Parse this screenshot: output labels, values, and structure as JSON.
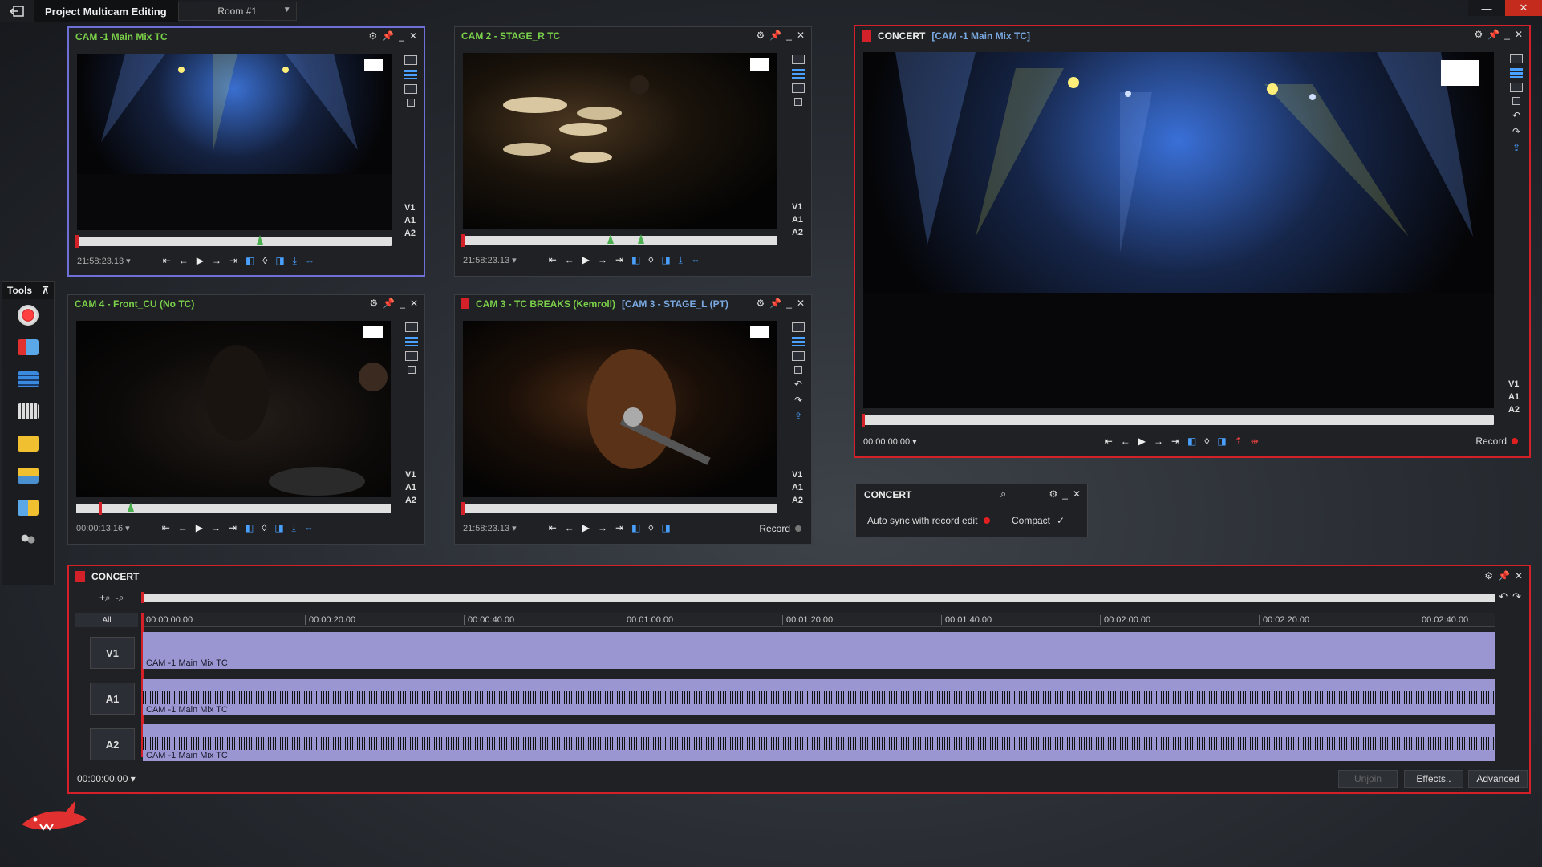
{
  "app": {
    "project": "Project Multicam Editing",
    "room": "Room #1"
  },
  "colors": {
    "accent_red": "#d42028",
    "select": "#6f6fd8",
    "clip": "#9a96d2",
    "cam_green": "#7bd04a"
  },
  "cam1": {
    "title": "CAM -1 Main Mix TC",
    "tc": "21:58:23.13 ▾",
    "tracks": [
      "V1",
      "A1",
      "A2"
    ]
  },
  "cam2": {
    "title": "CAM 2 - STAGE_R TC",
    "tc": "21:58:23.13 ▾",
    "tracks": [
      "V1",
      "A1",
      "A2"
    ]
  },
  "cam4": {
    "title": "CAM 4 - Front_CU  (No TC)",
    "tc": "00:00:13.16 ▾",
    "tracks": [
      "V1",
      "A1",
      "A2"
    ]
  },
  "cam3": {
    "title": "CAM 3 - TC BREAKS (Kemroll)",
    "sub": "[CAM 3 - STAGE_L (PT)",
    "tc": "21:58:23.13 ▾",
    "record": "Record",
    "tracks": [
      "V1",
      "A1",
      "A2"
    ]
  },
  "record": {
    "title": "CONCERT",
    "sub": "[CAM -1 Main Mix TC]",
    "tc": "00:00:00.00 ▾",
    "record": "Record",
    "tracks": [
      "V1",
      "A1",
      "A2"
    ]
  },
  "tools": {
    "title": "Tools"
  },
  "concert_panel": {
    "title": "CONCERT",
    "auto_sync": "Auto sync with record edit",
    "compact": "Compact",
    "check": "✓"
  },
  "timeline": {
    "title": "CONCERT",
    "all": "All",
    "tc": "00:00:00.00 ▾",
    "ruler": [
      "00:00:00.00",
      "00:00:20.00",
      "00:00:40.00",
      "00:01:00.00",
      "00:01:20.00",
      "00:01:40.00",
      "00:02:00.00",
      "00:02:20.00",
      "00:02:40.00"
    ],
    "tracks": [
      "V1",
      "A1",
      "A2"
    ],
    "clip_name": "CAM -1 Main Mix TC",
    "buttons": {
      "unjoin": "Unjoin",
      "effects": "Effects..",
      "advanced": "Advanced"
    }
  },
  "transport": {
    "start": "⇤",
    "back": "←",
    "play": "▶",
    "fwd": "→",
    "end": "⇥"
  }
}
